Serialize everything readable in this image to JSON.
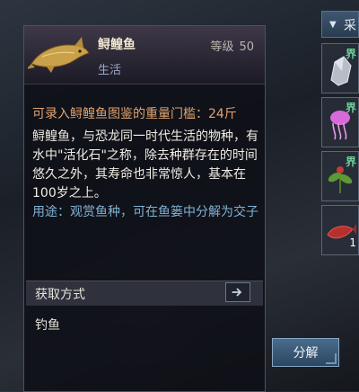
{
  "tooltip": {
    "item_name": "鲟鳇鱼",
    "item_category": "生活",
    "level_label": "等级",
    "level_value": "50",
    "icon": "sturgeon-fish-icon",
    "threshold_text": "可录入鲟鳇鱼图鉴的重量门槛：24斤",
    "description": "鲟鳇鱼，与恐龙同一时代生活的物种，有水中\"活化石\"之称，除去种群存在的时间悠久之外，其寿命也非常惊人，基本在100岁之上。",
    "usage": "用途：观赏鱼种，可在鱼篓中分解为交子",
    "acquire_title": "获取方式",
    "acquire_method": "钓鱼"
  },
  "side_panel": {
    "tab_label": "采",
    "tab_icon": "triangle-down-icon",
    "slots": [
      {
        "badge": "界",
        "icon": "crystal-icon",
        "count": ""
      },
      {
        "badge": "界",
        "icon": "jellyfish-icon",
        "count": ""
      },
      {
        "badge": "界",
        "icon": "plant-icon",
        "count": ""
      },
      {
        "badge": "",
        "icon": "red-fish-icon",
        "count": "1"
      }
    ]
  },
  "actions": {
    "decompose_label": "分解"
  },
  "colors": {
    "threshold": "#e1a36e",
    "usage": "#7fb3d6",
    "category": "#9aa8c8"
  }
}
